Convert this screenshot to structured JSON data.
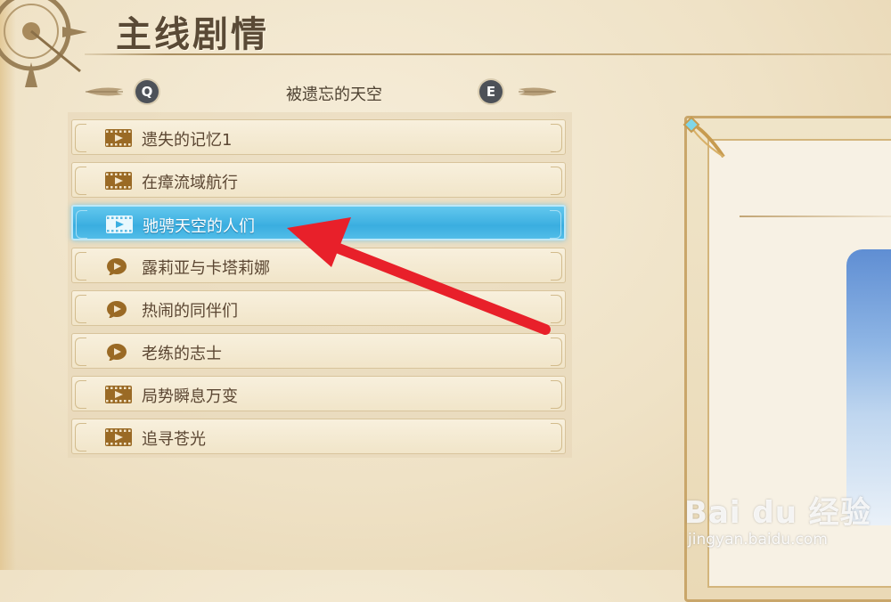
{
  "header": {
    "title": "主线剧情"
  },
  "chapter_nav": {
    "prev_key": "Q",
    "next_key": "E",
    "title": "被遗忘的天空"
  },
  "story_list": [
    {
      "label": "遗失的记忆1",
      "icon": "film-icon",
      "selected": false
    },
    {
      "label": "在瘴流域航行",
      "icon": "film-icon",
      "selected": false
    },
    {
      "label": "驰骋天空的人们",
      "icon": "film-icon",
      "selected": true
    },
    {
      "label": "露莉亚与卡塔莉娜",
      "icon": "speech-bubble-icon",
      "selected": false
    },
    {
      "label": "热闹的同伴们",
      "icon": "speech-bubble-icon",
      "selected": false
    },
    {
      "label": "老练的志士",
      "icon": "speech-bubble-icon",
      "selected": false
    },
    {
      "label": "局势瞬息万变",
      "icon": "film-icon",
      "selected": false
    },
    {
      "label": "追寻苍光",
      "icon": "film-icon",
      "selected": false
    }
  ],
  "watermark": {
    "brand": "Bai du 经验",
    "url": "jingyan.baidu.com"
  },
  "colors": {
    "selected_row": "#3aaee0",
    "icon_brown": "#9a6a25",
    "arrow_red": "#e8202a"
  }
}
